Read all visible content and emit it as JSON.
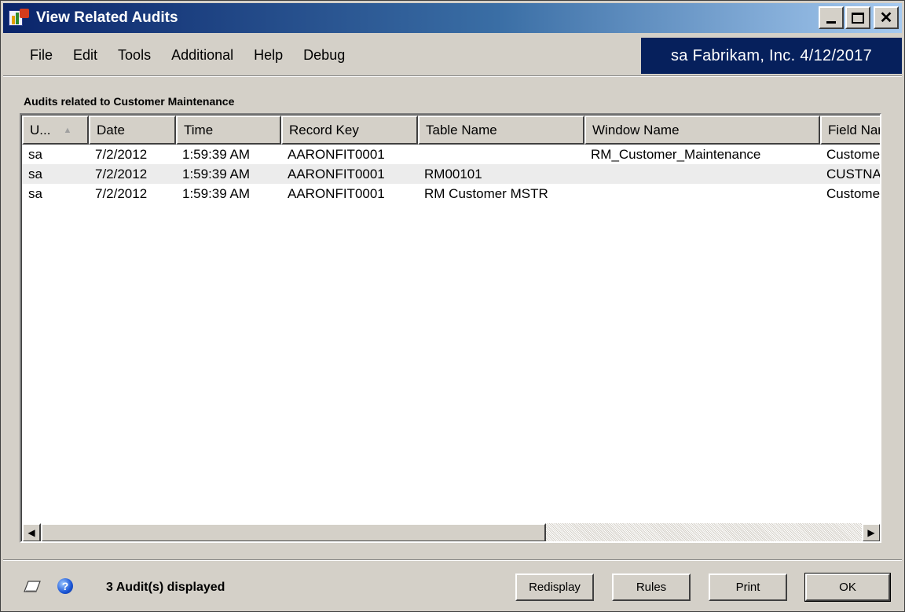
{
  "window": {
    "title": "View Related Audits"
  },
  "menu": [
    "File",
    "Edit",
    "Tools",
    "Additional",
    "Help",
    "Debug"
  ],
  "company_info": "sa  Fabrikam, Inc.  4/12/2017",
  "section_label": "Audits related to Customer Maintenance",
  "grid": {
    "columns": [
      "U...",
      "Date",
      "Time",
      "Record Key",
      "Table Name",
      "Window Name",
      "Field Nar"
    ],
    "rows": [
      [
        "sa",
        "7/2/2012",
        "1:59:39 AM",
        "AARONFIT0001",
        "",
        "RM_Customer_Maintenance",
        "Custome"
      ],
      [
        "sa",
        "7/2/2012",
        "1:59:39 AM",
        "AARONFIT0001",
        "RM00101",
        "",
        "CUSTNA"
      ],
      [
        "sa",
        "7/2/2012",
        "1:59:39 AM",
        "AARONFIT0001",
        "RM Customer MSTR",
        "",
        "Custome"
      ]
    ]
  },
  "status": "3 Audit(s) displayed",
  "buttons": {
    "redisplay": "Redisplay",
    "rules": "Rules",
    "print": "Print",
    "ok": "OK"
  },
  "icons": [
    "note-icon",
    "help-icon",
    "minimize-icon",
    "maximize-icon",
    "close-icon",
    "app-icon",
    "scroll-left-icon",
    "scroll-right-icon"
  ],
  "colors": {
    "title_start": "#0a246a",
    "company_bg": "#06205c",
    "face": "#d4d0c8"
  }
}
